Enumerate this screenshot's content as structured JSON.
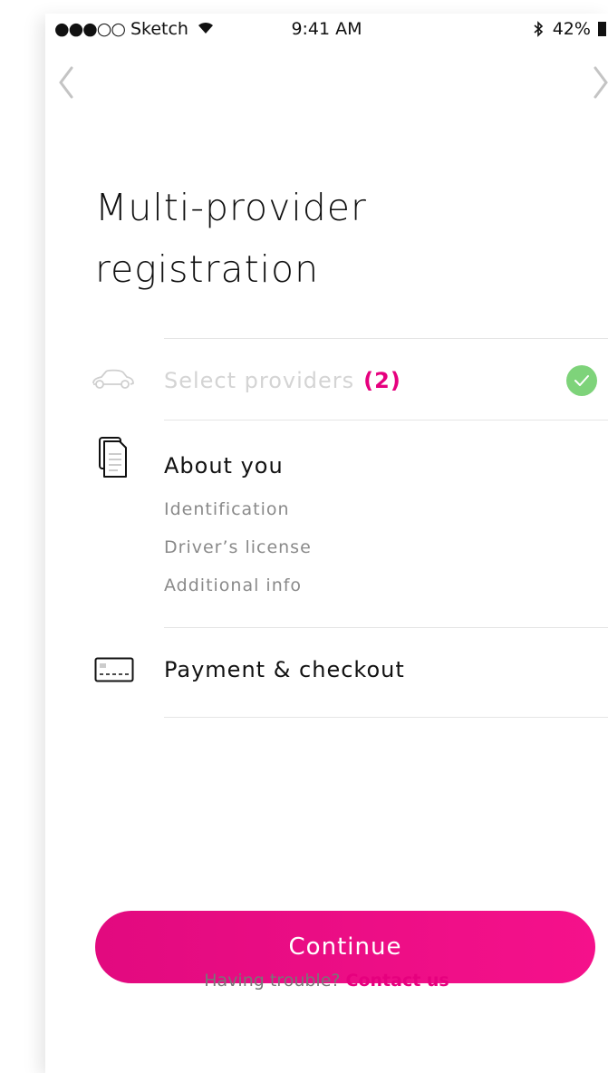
{
  "status_bar": {
    "carrier": "Sketch",
    "time": "9:41 AM",
    "battery": "42%"
  },
  "nav": {
    "back_icon": "chevron-left-icon",
    "forward_icon": "chevron-right-icon"
  },
  "title": {
    "line1": "Multi-provider",
    "line2": "registration"
  },
  "steps": [
    {
      "icon": "car-icon",
      "label": "Select providers",
      "count": "(2)",
      "state": "completed",
      "status_icon": "check-icon"
    },
    {
      "icon": "documents-icon",
      "label": "About you",
      "substeps": [
        "Identification",
        "Driver’s license",
        "Additional info"
      ]
    },
    {
      "icon": "credit-card-icon",
      "label": "Payment & checkout"
    }
  ],
  "actions": {
    "continue_label": "Continue",
    "help_text": "Having trouble?",
    "contact_link": "Contact us"
  },
  "colors": {
    "accent": "#e6007e",
    "success": "#7ed37a",
    "muted": "#d4d4d4"
  }
}
